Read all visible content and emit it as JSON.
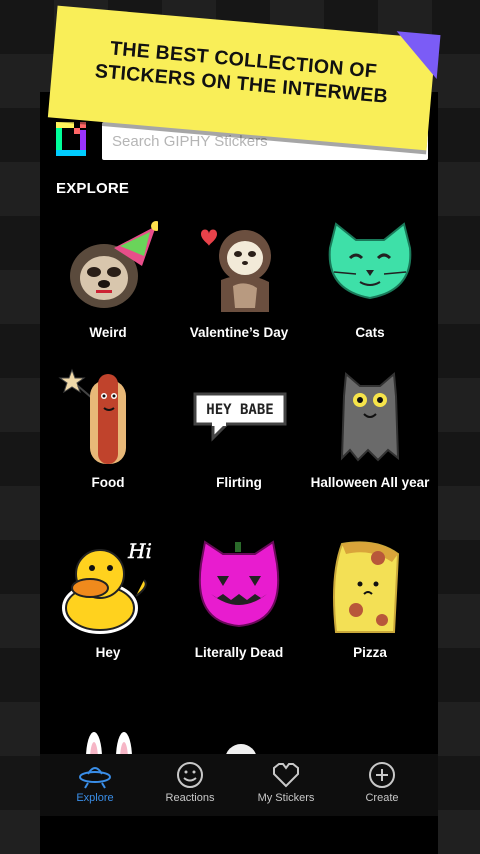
{
  "banner": {
    "line1": "THE BEST COLLECTION OF",
    "line2": "STICKERS ON THE INTERWEB"
  },
  "search": {
    "placeholder": "Search GIPHY Stickers",
    "value": ""
  },
  "explore": {
    "title": "EXPLORE",
    "categories": [
      {
        "label": "Weird",
        "icon": "sloth-party-hat-icon"
      },
      {
        "label": "Valentine’s Day",
        "icon": "sloth-heart-icon"
      },
      {
        "label": "Cats",
        "icon": "green-cat-icon"
      },
      {
        "label": "Food",
        "icon": "hotdog-icon"
      },
      {
        "label": "Flirting",
        "icon": "hey-babe-speech-bubble-icon",
        "bubble_text": "HEY BABE"
      },
      {
        "label": "Halloween All year",
        "icon": "ghost-cat-icon"
      },
      {
        "label": "Hey",
        "icon": "rubber-duck-hi-icon",
        "bubble_text": "Hi"
      },
      {
        "label": "Literally Dead",
        "icon": "pink-jack-o-lantern-cat-icon"
      },
      {
        "label": "Pizza",
        "icon": "pizza-slice-icon"
      }
    ]
  },
  "tabs": [
    {
      "label": "Explore",
      "icon": "ufo-icon",
      "active": true
    },
    {
      "label": "Reactions",
      "icon": "smiley-face-icon",
      "active": false
    },
    {
      "label": "My Stickers",
      "icon": "heart-outline-icon",
      "active": false
    },
    {
      "label": "Create",
      "icon": "plus-circle-icon",
      "active": false
    }
  ],
  "colors": {
    "banner": "#f9ee58",
    "accent": "#3a8ee8",
    "corner": "#7b5cf6"
  }
}
